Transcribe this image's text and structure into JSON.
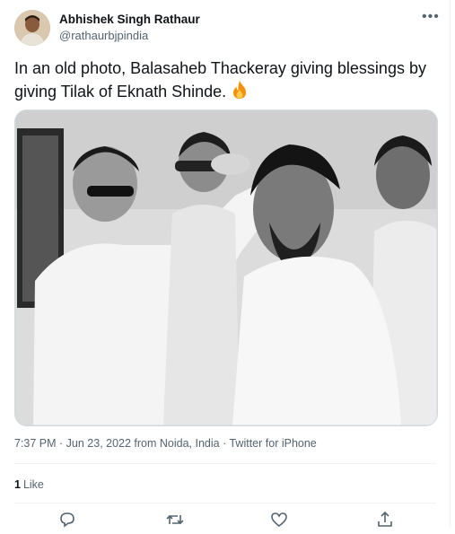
{
  "tweet": {
    "author_name": "Abhishek Singh Rathaur",
    "author_handle": "@rathaurbjpindia",
    "text": "In an old photo, Balasaheb Thackeray giving blessings by giving Tilak of Eknath Shinde.",
    "emoji_icon": "fire-icon",
    "timestamp": "7:37 PM · Jun 23, 2022 from Noida, India · Twitter for iPhone",
    "like_count": "1",
    "like_label": "Like"
  },
  "icons": {
    "more": "more-options-icon",
    "reply": "reply-icon",
    "retweet": "retweet-icon",
    "like": "heart-icon",
    "share": "share-icon"
  },
  "colors": {
    "text": "#0f1419",
    "secondary": "#536471",
    "border": "#eff3f4",
    "fire": "#f4900c"
  }
}
